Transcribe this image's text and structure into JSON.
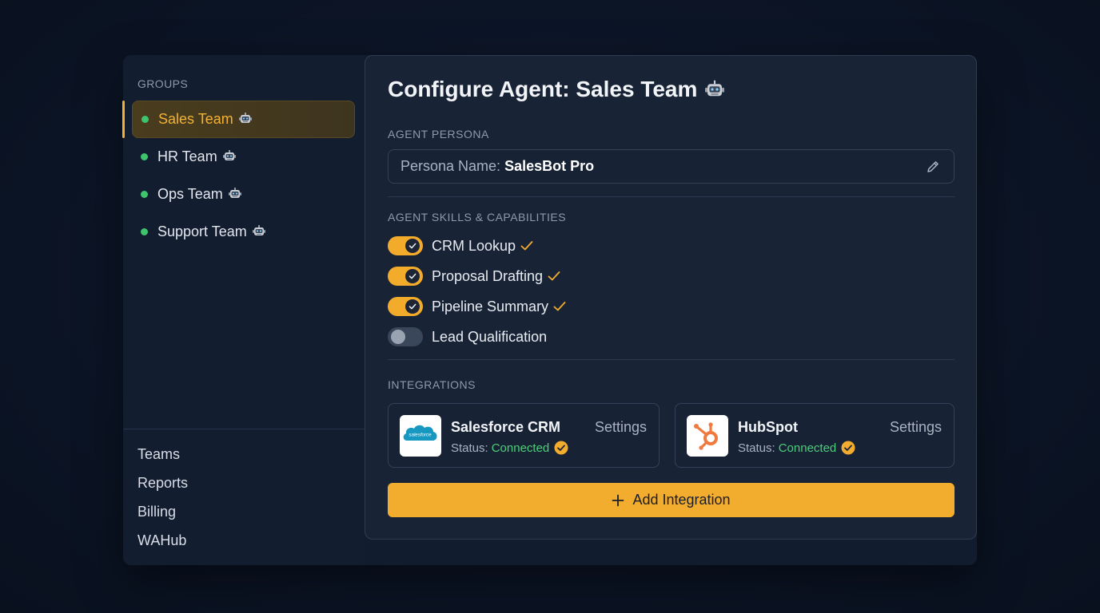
{
  "sidebar": {
    "groups_label": "GROUPS",
    "groups": [
      {
        "label": "Sales Team",
        "active": true
      },
      {
        "label": "HR Team",
        "active": false
      },
      {
        "label": "Ops Team",
        "active": false
      },
      {
        "label": "Support Team",
        "active": false
      }
    ],
    "nav": [
      "Teams",
      "Reports",
      "Billing",
      "WAHub"
    ]
  },
  "main": {
    "title": "Configure Agent: Sales Team",
    "persona": {
      "section_label": "AGENT PERSONA",
      "prefix": "Persona Name:",
      "value": "SalesBot Pro"
    },
    "skills": {
      "section_label": "AGENT SKILLS & CAPABILITIES",
      "items": [
        {
          "label": "CRM Lookup",
          "enabled": true
        },
        {
          "label": "Proposal Drafting",
          "enabled": true
        },
        {
          "label": "Pipeline Summary",
          "enabled": true
        },
        {
          "label": "Lead Qualification",
          "enabled": false
        }
      ]
    },
    "integrations": {
      "section_label": "INTEGRATIONS",
      "items": [
        {
          "name": "Salesforce CRM",
          "status_prefix": "Status:",
          "status": "Connected",
          "settings_label": "Settings",
          "logo_text": "salesforce"
        },
        {
          "name": "HubSpot",
          "status_prefix": "Status:",
          "status": "Connected",
          "settings_label": "Settings"
        }
      ],
      "add_label": "Add Integration"
    }
  },
  "colors": {
    "accent": "#f3ad2e",
    "connected": "#4ccf79",
    "status_dot": "#3ec46d",
    "salesforce_blue": "#1798c1",
    "hubspot_orange": "#f0793f"
  },
  "icons": {
    "robot": "robot-icon",
    "edit": "pencil-icon",
    "check": "check-icon",
    "plus": "plus-icon"
  }
}
